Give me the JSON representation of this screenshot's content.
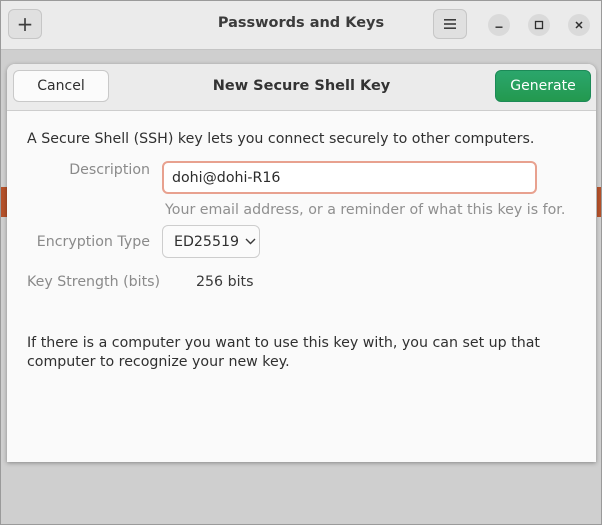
{
  "app": {
    "title": "Passwords and Keys",
    "add_symbol": "+"
  },
  "dialog": {
    "title": "New Secure Shell Key",
    "cancel_label": "Cancel",
    "generate_label": "Generate",
    "intro": "A Secure Shell (SSH) key lets you connect securely to other computers.",
    "description": {
      "label": "Description",
      "value": "dohi@dohi-R16",
      "hint": "Your email address, or a reminder of what this key is for."
    },
    "encryption": {
      "label": "Encryption Type",
      "selected": "ED25519"
    },
    "strength": {
      "label": "Key Strength (bits)",
      "value": "256 bits"
    },
    "footer": "If there is a computer you want to use this key with, you can set up that computer to recognize your new key."
  },
  "colors": {
    "accent_green": "#26a269",
    "focus_border": "#e8a18f",
    "background_accent": "#b5512a"
  },
  "icons": {
    "add": "plus-icon",
    "menu": "hamburger-menu-icon",
    "minimize": "minimize-icon",
    "maximize": "maximize-icon",
    "close": "close-icon",
    "dropdown": "chevron-down-icon"
  }
}
